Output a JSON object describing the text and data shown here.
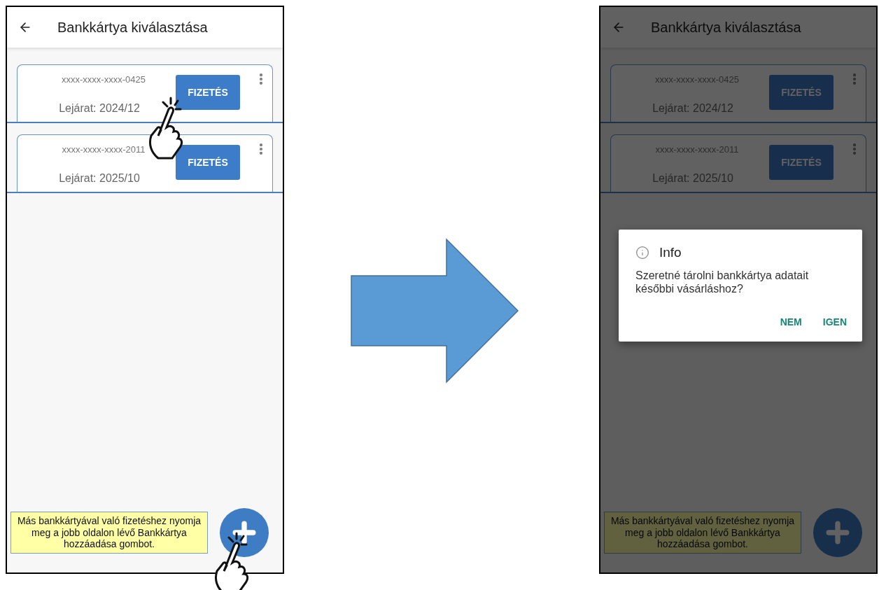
{
  "screens": [
    {
      "title": "Bankkártya kiválasztása",
      "cards": [
        {
          "number": "xxxx-xxxx-xxxx-0425",
          "expiry": "Lejárat: 2024/12",
          "button": "FIZETÉS"
        },
        {
          "number": "xxxx-xxxx-xxxx-2011",
          "expiry": "Lejárat: 2025/10",
          "button": "FIZETÉS"
        }
      ],
      "hint": "Más bankkártyával való fizetéshez nyomja meg a jobb oldalon lévő Bankkártya hozzáadása gombot.",
      "dimmed": false,
      "tap_markers": true
    },
    {
      "title": "Bankkártya kiválasztása",
      "cards": [
        {
          "number": "xxxx-xxxx-xxxx-0425",
          "expiry": "Lejárat: 2024/12",
          "button": "FIZETÉS"
        },
        {
          "number": "xxxx-xxxx-xxxx-2011",
          "expiry": "Lejárat: 2025/10",
          "button": "FIZETÉS"
        }
      ],
      "hint": "Más bankkártyával való fizetéshez nyomja meg a jobb oldalon lévő Bankkártya hozzáadása gombot.",
      "dimmed": true,
      "tap_markers": false,
      "dialog": {
        "title": "Info",
        "message": "Szeretné tárolni bankkártya adatait későbbi vásárláshoz?",
        "actions": [
          "NEM",
          "IGEN"
        ]
      }
    }
  ]
}
